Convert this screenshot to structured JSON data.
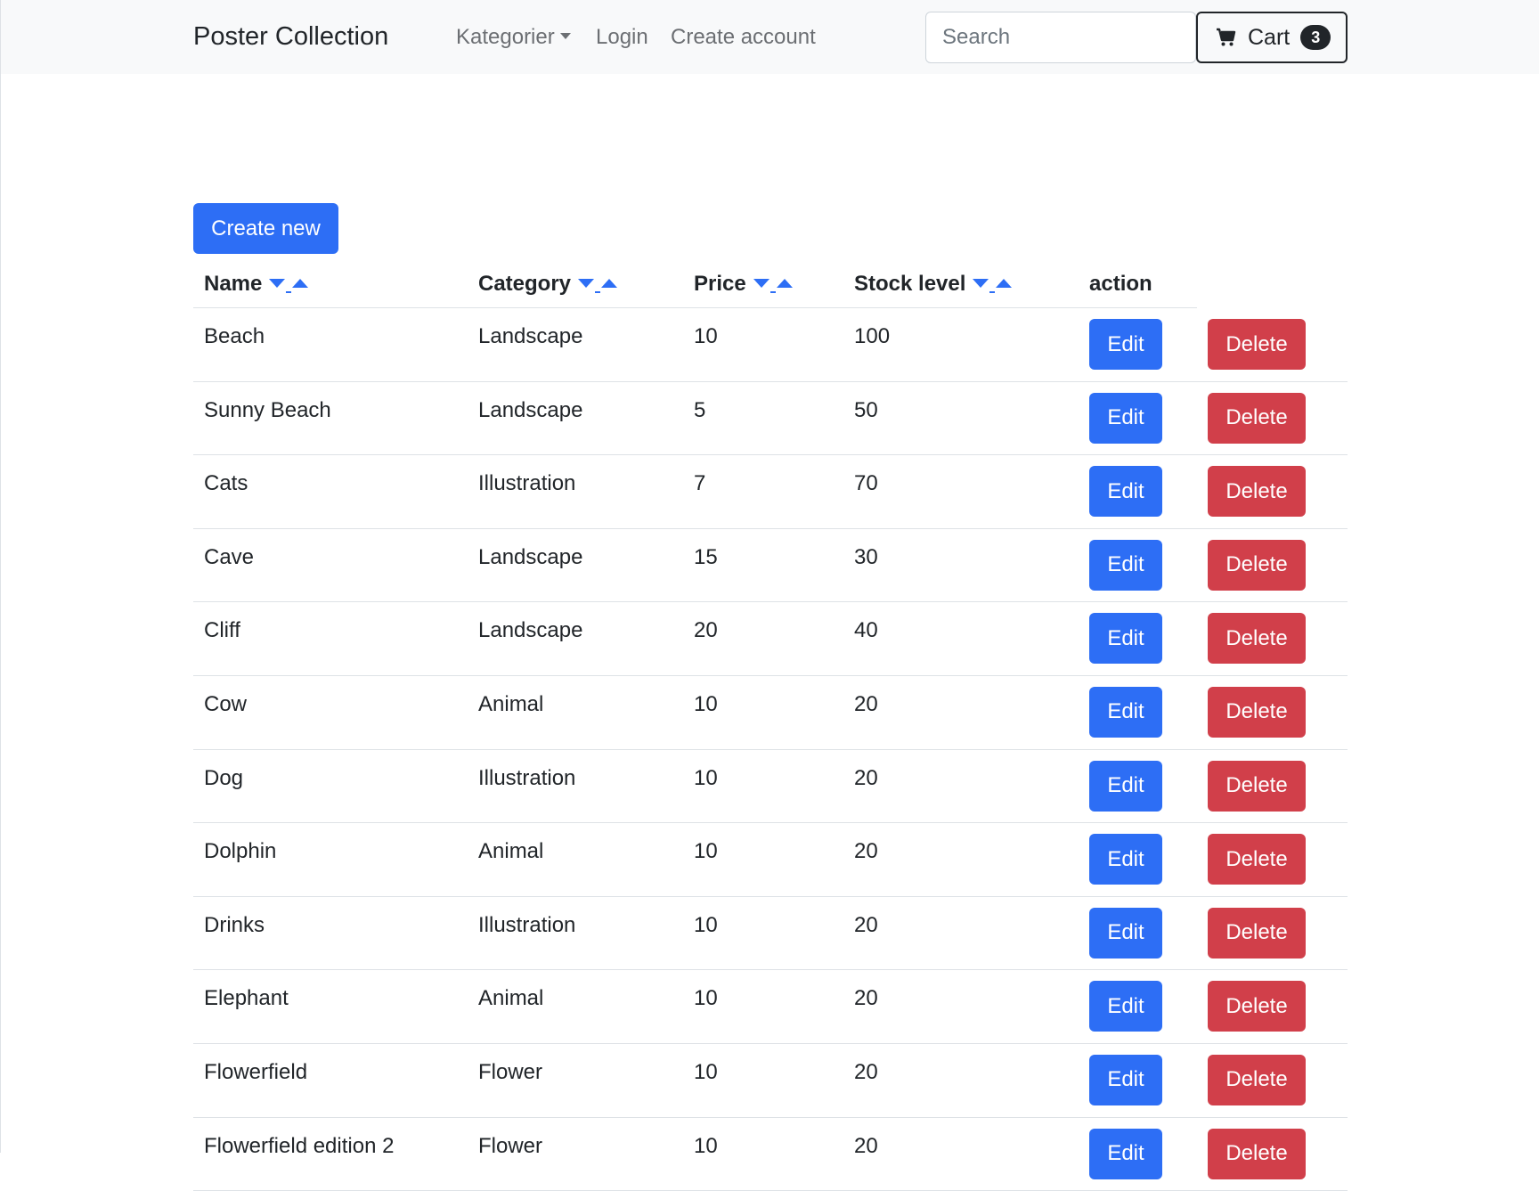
{
  "navbar": {
    "brand": "Poster Collection",
    "links": {
      "kategorier": "Kategorier",
      "login": "Login",
      "create_account": "Create account"
    },
    "search": {
      "placeholder": "Search",
      "value": ""
    },
    "cart": {
      "label": "Cart",
      "count": "3",
      "icon": "cart-icon"
    }
  },
  "toolbar": {
    "create_label": "Create new"
  },
  "table": {
    "headers": {
      "name": "Name",
      "category": "Category",
      "price": "Price",
      "stock": "Stock level",
      "action": "action"
    },
    "edit_label": "Edit",
    "delete_label": "Delete",
    "rows": [
      {
        "name": "Beach",
        "category": "Landscape",
        "price": "10",
        "stock": "100"
      },
      {
        "name": "Sunny Beach",
        "category": "Landscape",
        "price": "5",
        "stock": "50"
      },
      {
        "name": "Cats",
        "category": "Illustration",
        "price": "7",
        "stock": "70"
      },
      {
        "name": "Cave",
        "category": "Landscape",
        "price": "15",
        "stock": "30"
      },
      {
        "name": "Cliff",
        "category": "Landscape",
        "price": "20",
        "stock": "40"
      },
      {
        "name": "Cow",
        "category": "Animal",
        "price": "10",
        "stock": "20"
      },
      {
        "name": "Dog",
        "category": "Illustration",
        "price": "10",
        "stock": "20"
      },
      {
        "name": "Dolphin",
        "category": "Animal",
        "price": "10",
        "stock": "20"
      },
      {
        "name": "Drinks",
        "category": "Illustration",
        "price": "10",
        "stock": "20"
      },
      {
        "name": "Elephant",
        "category": "Animal",
        "price": "10",
        "stock": "20"
      },
      {
        "name": "Flowerfield",
        "category": "Flower",
        "price": "10",
        "stock": "20"
      },
      {
        "name": "Flowerfield edition 2",
        "category": "Flower",
        "price": "10",
        "stock": "20"
      }
    ]
  },
  "colors": {
    "primary": "#2d6ef5",
    "danger": "#d13f4a",
    "navbar_bg": "#f8f9fa",
    "text": "#212529"
  }
}
